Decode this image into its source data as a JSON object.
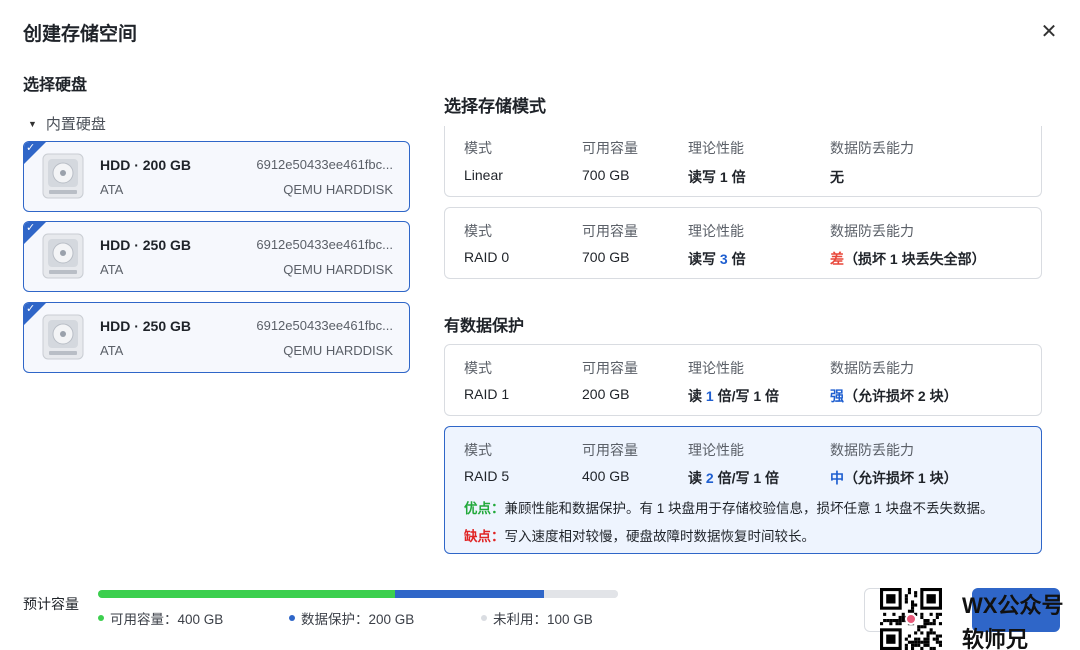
{
  "dialog": {
    "title": "创建存储空间",
    "close_icon": "close-icon"
  },
  "disk_select": {
    "title": "选择硬盘",
    "group_label": "内置硬盘",
    "disks": [
      {
        "name": "HDD · 200 GB",
        "serial": "6912e50433ee461fbc...",
        "bus": "ATA",
        "model": "QEMU HARDDISK",
        "selected": true
      },
      {
        "name": "HDD · 250 GB",
        "serial": "6912e50433ee461fbc...",
        "bus": "ATA",
        "model": "QEMU HARDDISK",
        "selected": true
      },
      {
        "name": "HDD · 250 GB",
        "serial": "6912e50433ee461fbc...",
        "bus": "ATA",
        "model": "QEMU HARDDISK",
        "selected": true
      }
    ]
  },
  "mode_select": {
    "title": "选择存储模式",
    "protected_section_title": "有数据保护",
    "headers": {
      "mode": "模式",
      "capacity": "可用容量",
      "performance": "理论性能",
      "protection": "数据防丢能力"
    },
    "modes": [
      {
        "mode": "Linear",
        "capacity": "700 GB",
        "perf_parts": [
          "读写 1 倍"
        ],
        "prot_level": "无",
        "prot_detail": ""
      },
      {
        "mode": "RAID 0",
        "capacity": "700 GB",
        "perf_parts": [
          "读写 ",
          "3",
          " 倍"
        ],
        "prot_level": "差",
        "prot_detail": "（损坏 1 块丢失全部）"
      },
      {
        "mode": "RAID 1",
        "capacity": "200 GB",
        "perf_parts": [
          "读 ",
          "1",
          " 倍/写 1 倍"
        ],
        "prot_level": "强",
        "prot_detail": "（允许损坏 2 块）"
      },
      {
        "mode": "RAID 5",
        "capacity": "400 GB",
        "perf_parts": [
          "读 ",
          "2",
          " 倍/写 1 倍"
        ],
        "prot_level": "中",
        "prot_detail": "（允许损坏 1 块）",
        "pros_label": "优点：",
        "pros_text": "兼顾性能和数据保护。有 1 块盘用于存储校验信息，损坏任意 1 块盘不丢失数据。",
        "cons_label": "缺点：",
        "cons_text": "写入速度相对较慢，硬盘故障时数据恢复时间较长。",
        "selected": true
      }
    ]
  },
  "capacity": {
    "label": "预计容量",
    "segments": [
      {
        "label": "可用容量：400 GB",
        "value_gb": 400,
        "color": "#3ccf4e"
      },
      {
        "label": "数据保护：200 GB",
        "value_gb": 200,
        "color": "#2f66c8"
      },
      {
        "label": "未利用：100 GB",
        "value_gb": 100,
        "color": "#e2e4e8"
      }
    ]
  },
  "watermark": {
    "line1": "WX公众号",
    "line2": "软师兄"
  },
  "colors": {
    "accent": "#2f66c8",
    "green": "#3ccf4e",
    "danger": "#e8483b"
  }
}
